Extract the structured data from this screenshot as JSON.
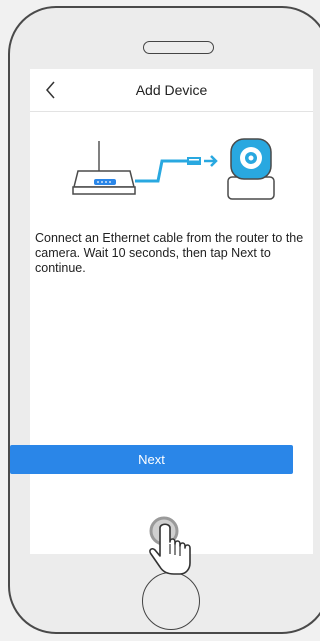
{
  "header": {
    "title": "Add Device"
  },
  "main": {
    "instructions": "Connect an Ethernet cable from the router to the camera. Wait 10 seconds, then tap Next to continue."
  },
  "actions": {
    "next_label": "Next"
  },
  "icons": {
    "back": "chevron-left-icon",
    "router": "router-icon",
    "camera": "camera-icon",
    "tap": "hand-pointer-icon"
  },
  "colors": {
    "accent": "#2a86e8",
    "cable": "#29a8e0"
  }
}
